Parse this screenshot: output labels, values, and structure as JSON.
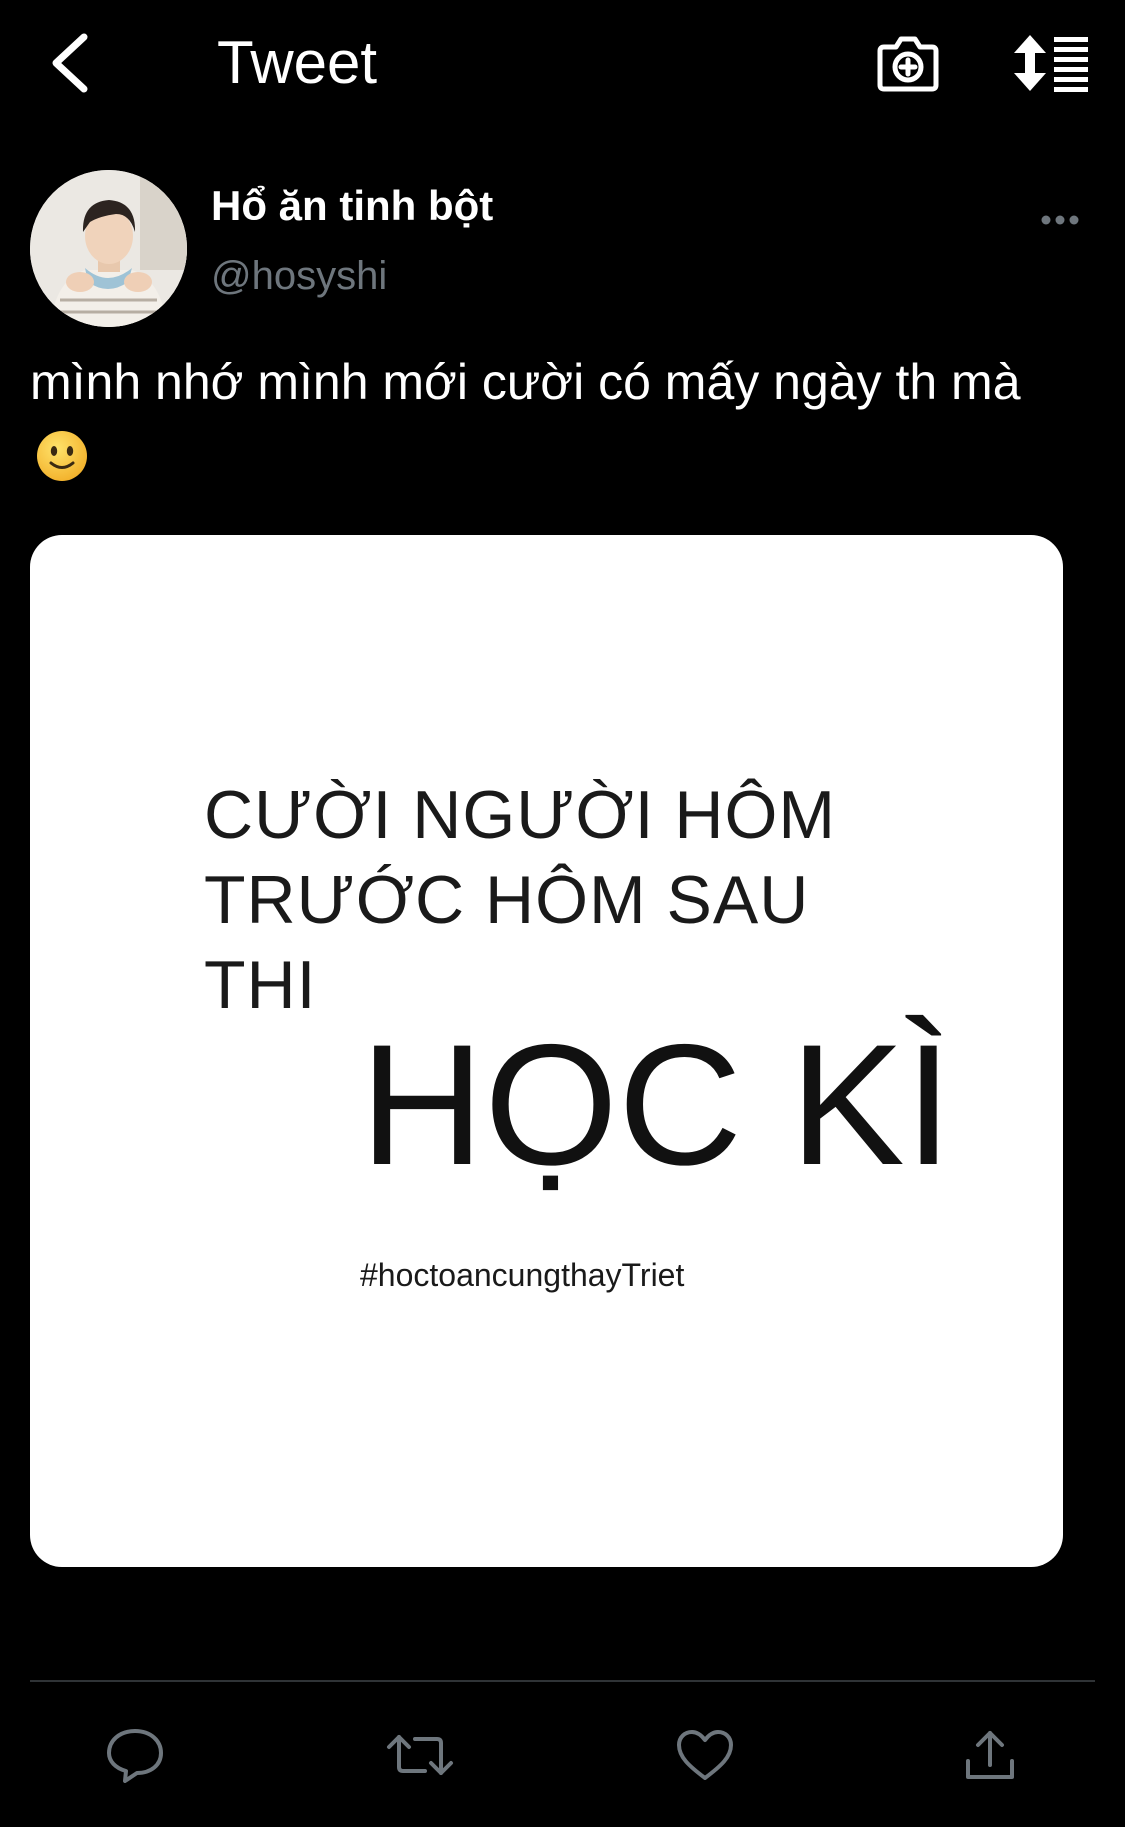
{
  "header": {
    "title": "Tweet",
    "back_icon": "chevron-left-icon",
    "camera_icon": "camera-plus-icon",
    "sort_icon": "sort-list-icon"
  },
  "author": {
    "display_name": "Hổ ăn tinh bột",
    "handle": "@hosyshi"
  },
  "tweet": {
    "text": "mình nhớ mình mới cười có mấy ngày th mà",
    "emoji": "slightly-smiling-face"
  },
  "media": {
    "line1": "CƯỜI NGƯỜI HÔM",
    "line2": "TRƯỚC HÔM SAU",
    "line3": "THI",
    "big": "HỌC KÌ",
    "hashtag": "#hoctoancungthayTriet"
  },
  "actions": [
    "reply-icon",
    "retweet-icon",
    "like-icon",
    "share-icon"
  ],
  "colors": {
    "background": "#000000",
    "text": "#ffffff",
    "secondary": "#6e767d",
    "divider": "#2f3336"
  }
}
